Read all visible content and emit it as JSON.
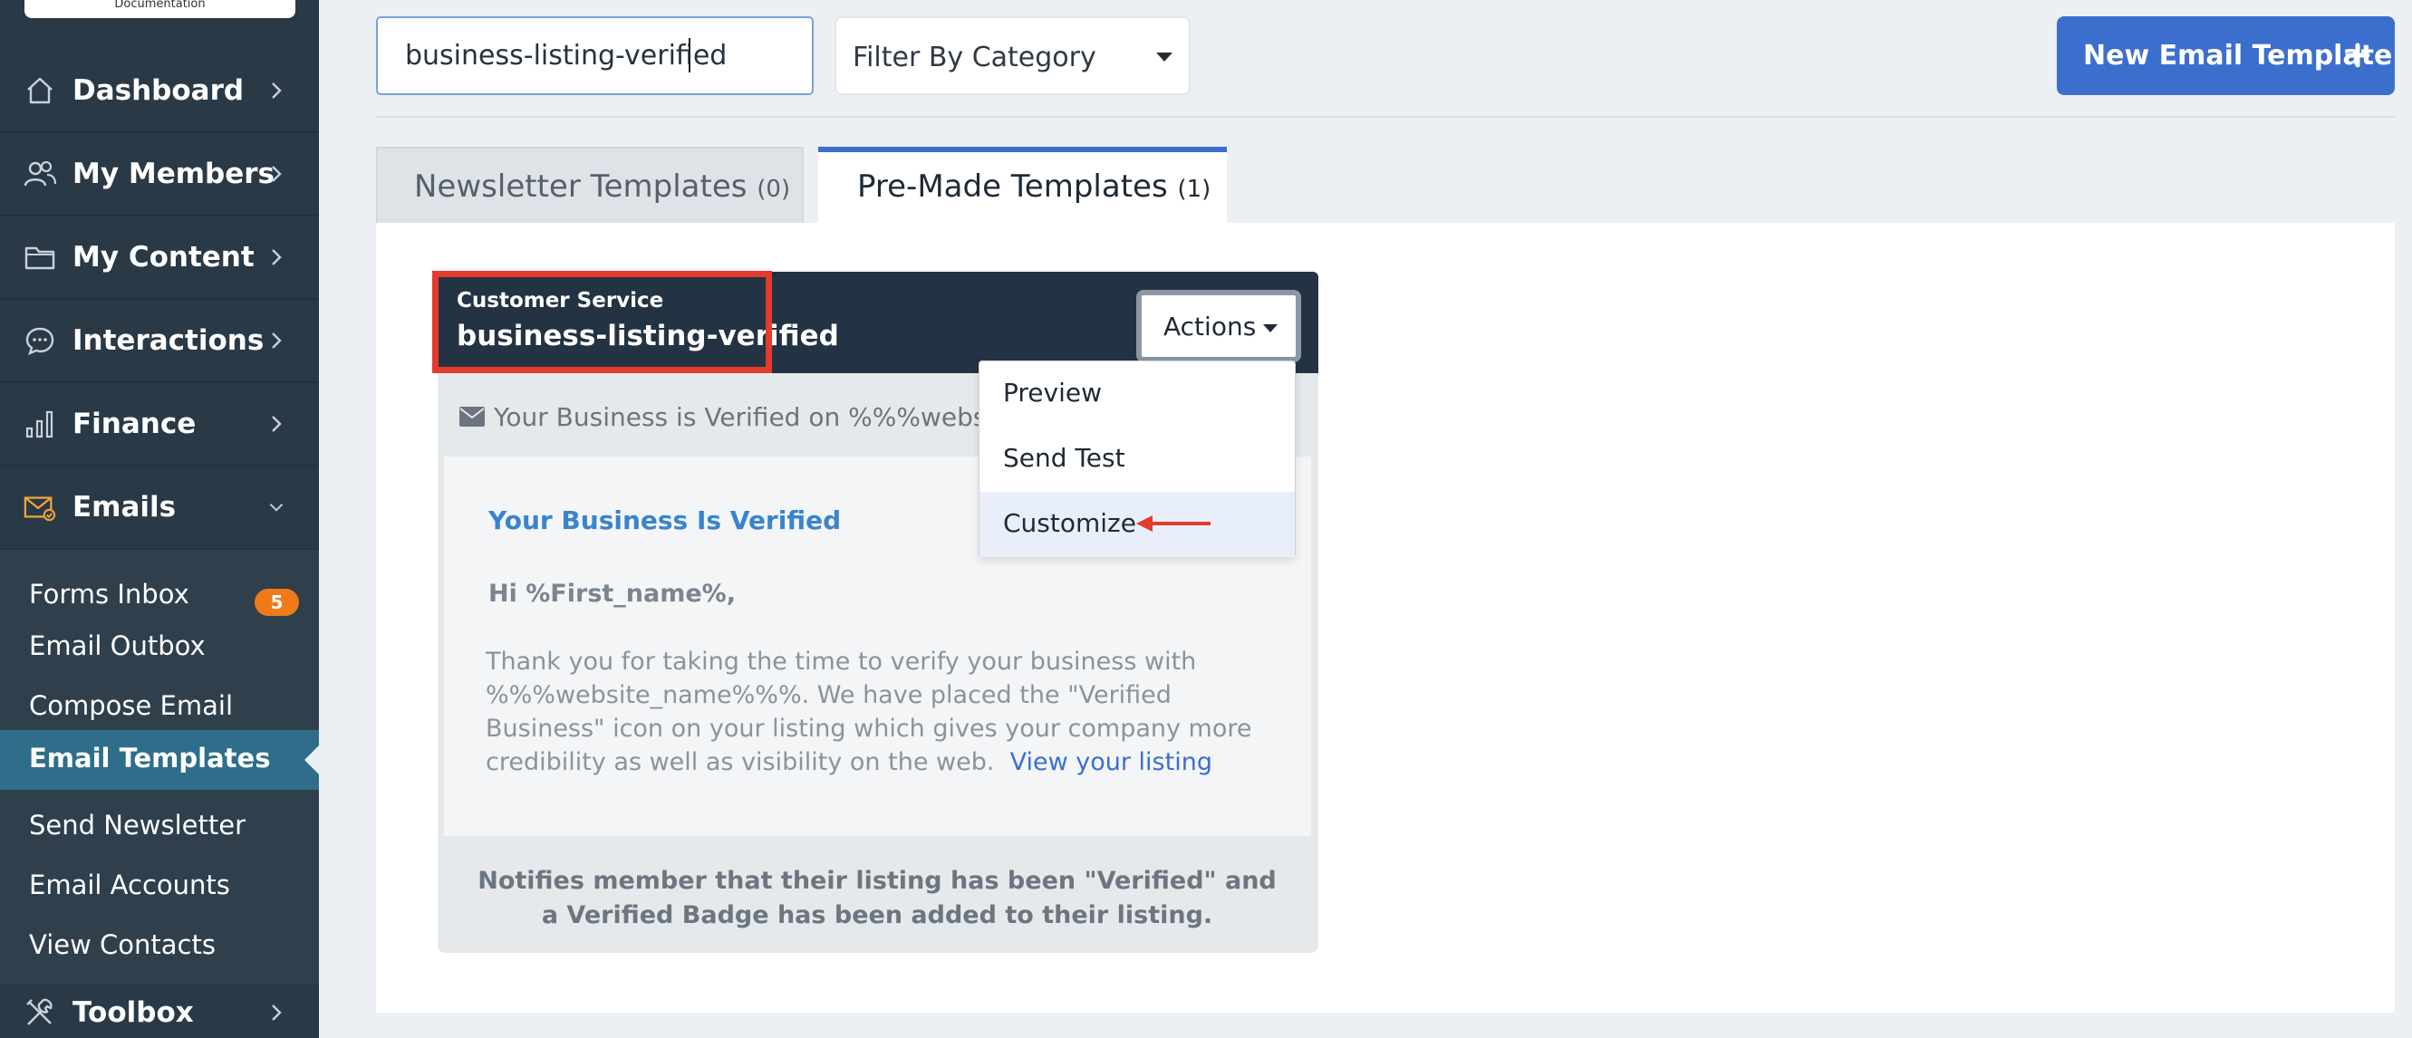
{
  "logo": {
    "text": "Documentation"
  },
  "sidebar": {
    "nav": [
      {
        "label": "Dashboard",
        "icon": "home-icon"
      },
      {
        "label": "My Members",
        "icon": "members-icon"
      },
      {
        "label": "My Content",
        "icon": "folder-icon"
      },
      {
        "label": "Interactions",
        "icon": "chat-icon"
      },
      {
        "label": "Finance",
        "icon": "bar-chart-icon"
      },
      {
        "label": "Emails",
        "icon": "email-icon",
        "expanded": true
      }
    ],
    "submenu": [
      {
        "label": "Forms Inbox",
        "badge": "5"
      },
      {
        "label": "Email Outbox"
      },
      {
        "label": "Compose Email"
      },
      {
        "label": "Email Templates",
        "active": true
      },
      {
        "label": "Send Newsletter"
      },
      {
        "label": "Email Accounts"
      },
      {
        "label": "View Contacts"
      }
    ],
    "toolbox": {
      "label": "Toolbox",
      "icon": "tools-icon"
    }
  },
  "search": {
    "value": "business-listing-verified"
  },
  "filter": {
    "label": "Filter By Category"
  },
  "new_template_button": {
    "label": "New Email Template"
  },
  "tabs": [
    {
      "label": "Newsletter Templates",
      "count": "(0)",
      "active": false
    },
    {
      "label": "Pre-Made Templates",
      "count": "(1)",
      "active": true
    }
  ],
  "template_card": {
    "category": "Customer Service",
    "name": "business-listing-verified",
    "actions_label": "Actions",
    "subject": "Your Business is Verified on %%%website_name%%%",
    "body_title": "Your Business Is Verified",
    "greeting": "Hi %First_name%,",
    "paragraph": "Thank you for taking the time to verify your business with %%%website_name%%%.  We have placed the \"Verified Business\" icon on your listing which gives your company more credibility as well as visibility on the web.",
    "link_text": "View your listing",
    "description": "Notifies member that their listing has been \"Verified\" and a Verified Badge has been added to their listing."
  },
  "actions_menu": {
    "items": [
      {
        "label": "Preview"
      },
      {
        "label": "Send Test"
      },
      {
        "label": "Customize",
        "highlighted": true
      }
    ]
  },
  "colors": {
    "sidebar_bg": "#2a3946",
    "accent_blue": "#3c6fcd",
    "active_submenu": "#2f6e8a",
    "badge_orange": "#f07a1a",
    "annotation_red": "#e63a2c",
    "card_header": "#243343"
  }
}
